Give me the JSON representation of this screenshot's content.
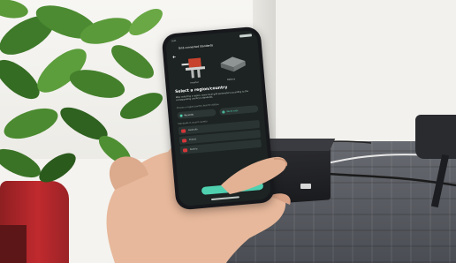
{
  "phone_screen": {
    "status_time": "9:41",
    "header_title": "Grid-connected Standards",
    "device_left_caption": "Inverter",
    "device_right_caption": "Battery",
    "section_title": "Select a region/country",
    "section_description": "After selecting a region, some local grid parameters according to the corresponding country's standards.",
    "hint": "Choose a region/country that PV utilizes",
    "tabs": [
      "Recently",
      "World wide"
    ],
    "list_heading": "Standards in recent country",
    "options": [
      "Australia",
      "Poland",
      "Austria"
    ],
    "confirm_label": ""
  },
  "colors": {
    "screen_background": "#1c2322",
    "accent": "#4fd1b0",
    "flag_red": "#d4373a",
    "wall": "#f4f3ef",
    "carpet": "#4e5156"
  },
  "icons": [
    "back-arrow-icon",
    "inverter-device-icon",
    "battery-device-icon",
    "radio-button-icon",
    "globe-icon"
  ]
}
